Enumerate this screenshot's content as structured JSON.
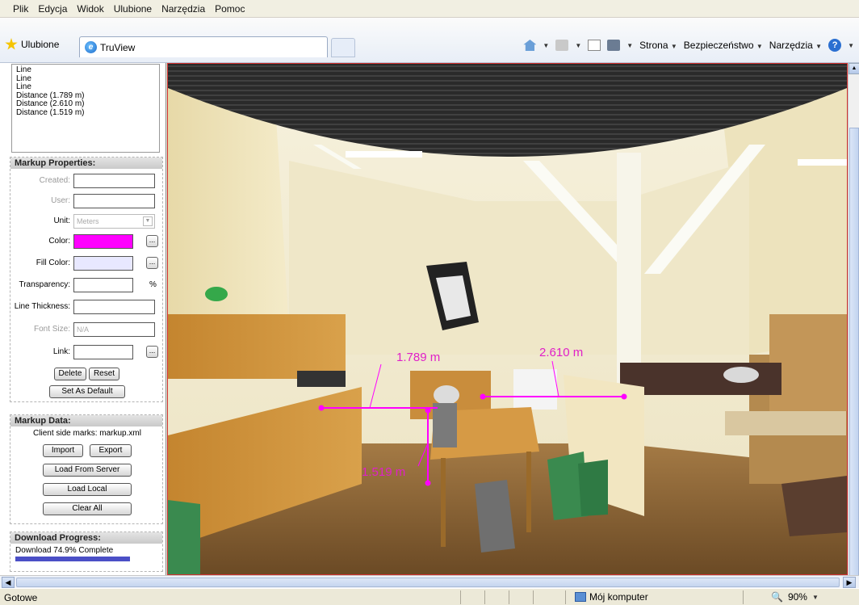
{
  "menu": [
    "Plik",
    "Edycja",
    "Widok",
    "Ulubione",
    "Narzędzia",
    "Pomoc"
  ],
  "toolbar": {
    "favorites_label": "Ulubione",
    "tab_title": "TruView",
    "strona": "Strona",
    "bezpieczenstwo": "Bezpieczeństwo",
    "narzedzia": "Narzędzia"
  },
  "markup_list": [
    "Line",
    "Line",
    "Line",
    "Distance (1.789 m)",
    "Distance (2.610 m)",
    "Distance (1.519 m)"
  ],
  "markup_properties": {
    "header": "Markup Properties:",
    "created_label": "Created:",
    "user_label": "User:",
    "unit_label": "Unit:",
    "unit_value": "Meters",
    "color_label": "Color:",
    "color_value": "#ff00ff",
    "fill_color_label": "Fill Color:",
    "fill_color_value": "#e8e8ff",
    "transparency_label": "Transparency:",
    "percent": "%",
    "line_thickness_label": "Line Thickness:",
    "font_size_label": "Font Size:",
    "font_size_value": "N/A",
    "link_label": "Link:",
    "dots": "...",
    "delete_btn": "Delete",
    "reset_btn": "Reset",
    "set_default_btn": "Set As Default"
  },
  "markup_data": {
    "header": "Markup Data:",
    "client_text": "Client side marks: markup.xml",
    "import_btn": "Import",
    "export_btn": "Export",
    "load_server_btn": "Load From Server",
    "load_local_btn": "Load Local",
    "clear_all_btn": "Clear All"
  },
  "download": {
    "header": "Download Progress:",
    "text": "Download 74.9% Complete",
    "progress": 0.749
  },
  "measurements": [
    {
      "label": "1.789 m"
    },
    {
      "label": "2.610 m"
    },
    {
      "label": "1.519 m"
    }
  ],
  "status": {
    "text": "Gotowe",
    "zone": "Mój komputer",
    "zoom": "90%"
  }
}
